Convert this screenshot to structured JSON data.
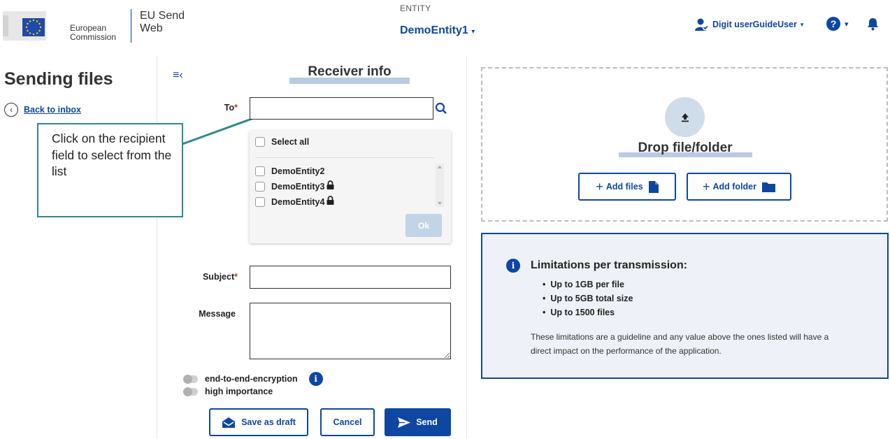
{
  "header": {
    "org_line1": "European",
    "org_line2": "Commission",
    "app_line1": "EU Send",
    "app_line2": "Web",
    "entity_label": "ENTITY",
    "entity_name": "DemoEntity1",
    "user_name": "Digit userGuideUser"
  },
  "sidebar": {
    "page_title": "Sending files",
    "back_link": "Back to inbox"
  },
  "callout": {
    "text": "Click on the recipient field to select from the list"
  },
  "form": {
    "section_title": "Receiver info",
    "to_label": "To",
    "to_value": "",
    "required_marker": "*",
    "select_all": "Select all",
    "recipients": [
      {
        "name": "DemoEntity2",
        "locked": false
      },
      {
        "name": "DemoEntity3",
        "locked": true
      },
      {
        "name": "DemoEntity4",
        "locked": true
      }
    ],
    "ok_label": "Ok",
    "subject_label": "Subject",
    "message_label": "Message",
    "toggle_encryption": "end-to-end-encryption",
    "toggle_importance": "high importance",
    "save_draft": "Save as draft",
    "cancel": "Cancel",
    "send": "Send"
  },
  "upload": {
    "title": "Drop file/folder",
    "add_files": "Add files",
    "add_folder": "Add folder"
  },
  "limits": {
    "title": "Limitations per transmission:",
    "items": [
      "Up to 1GB per file",
      "Up to 5GB total size",
      "Up to 1500 files"
    ],
    "note": "These limitations are a guideline and any value above the ones listed will have a direct impact on the performance of the application."
  },
  "colors": {
    "primary": "#0e47a1",
    "callout_border": "#2d8a8f",
    "limits_bg": "#eef2f8"
  }
}
